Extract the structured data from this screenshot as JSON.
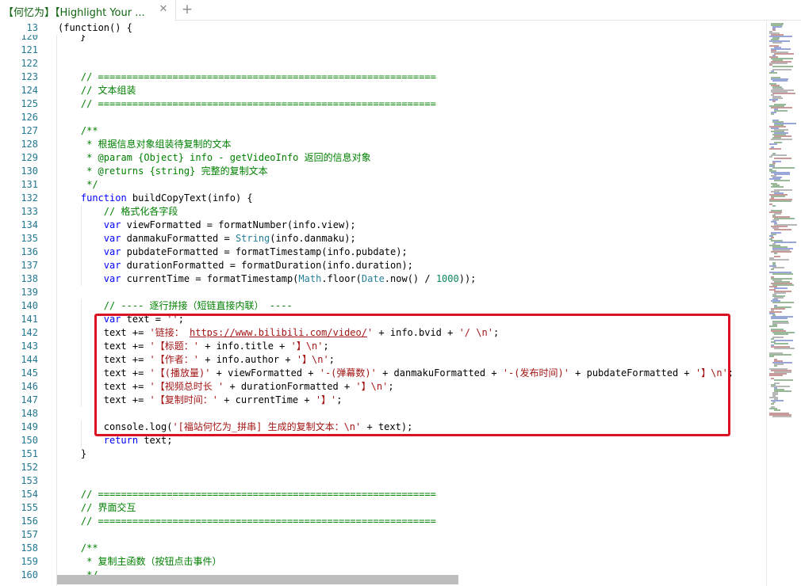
{
  "tab": {
    "title": "【何忆为】【Highlight Your ...",
    "close_glyph": "✕",
    "new_tab_glyph": "+"
  },
  "editor": {
    "sticky_line": {
      "number": "13",
      "text": "(function() {"
    },
    "partial_line": {
      "number": "120",
      "text": "}"
    },
    "lines": [
      {
        "number": "121",
        "indent": 0,
        "tokens": []
      },
      {
        "number": "122",
        "indent": 0,
        "tokens": []
      },
      {
        "number": "123",
        "indent": 1,
        "tokens": [
          {
            "t": "// ===========================================================",
            "c": "com"
          }
        ]
      },
      {
        "number": "124",
        "indent": 1,
        "tokens": [
          {
            "t": "// 文本组装",
            "c": "com"
          }
        ]
      },
      {
        "number": "125",
        "indent": 1,
        "tokens": [
          {
            "t": "// ===========================================================",
            "c": "com"
          }
        ]
      },
      {
        "number": "126",
        "indent": 0,
        "tokens": []
      },
      {
        "number": "127",
        "indent": 1,
        "tokens": [
          {
            "t": "/**",
            "c": "com"
          }
        ]
      },
      {
        "number": "128",
        "indent": 1,
        "tokens": [
          {
            "t": " * 根据信息对象组装待复制的文本",
            "c": "com"
          }
        ]
      },
      {
        "number": "129",
        "indent": 1,
        "tokens": [
          {
            "t": " * @param {Object} info - getVideoInfo 返回的信息对象",
            "c": "com"
          }
        ]
      },
      {
        "number": "130",
        "indent": 1,
        "tokens": [
          {
            "t": " * @returns {string} 完整的复制文本",
            "c": "com"
          }
        ]
      },
      {
        "number": "131",
        "indent": 1,
        "tokens": [
          {
            "t": " */",
            "c": "com"
          }
        ]
      },
      {
        "number": "132",
        "indent": 1,
        "tokens": [
          {
            "t": "function",
            "c": "kw"
          },
          {
            "t": " buildCopyText(info) {",
            "c": ""
          }
        ]
      },
      {
        "number": "133",
        "indent": 2,
        "tokens": [
          {
            "t": "// 格式化各字段",
            "c": "com"
          }
        ]
      },
      {
        "number": "134",
        "indent": 2,
        "tokens": [
          {
            "t": "var",
            "c": "kw"
          },
          {
            "t": " viewFormatted = formatNumber(info.view);",
            "c": ""
          }
        ]
      },
      {
        "number": "135",
        "indent": 2,
        "tokens": [
          {
            "t": "var",
            "c": "kw"
          },
          {
            "t": " danmakuFormatted = ",
            "c": ""
          },
          {
            "t": "String",
            "c": "type"
          },
          {
            "t": "(info.danmaku);",
            "c": ""
          }
        ]
      },
      {
        "number": "136",
        "indent": 2,
        "tokens": [
          {
            "t": "var",
            "c": "kw"
          },
          {
            "t": " pubdateFormatted = formatTimestamp(info.pubdate);",
            "c": ""
          }
        ]
      },
      {
        "number": "137",
        "indent": 2,
        "tokens": [
          {
            "t": "var",
            "c": "kw"
          },
          {
            "t": " durationFormatted = formatDuration(info.duration);",
            "c": ""
          }
        ]
      },
      {
        "number": "138",
        "indent": 2,
        "tokens": [
          {
            "t": "var",
            "c": "kw"
          },
          {
            "t": " currentTime = formatTimestamp(",
            "c": ""
          },
          {
            "t": "Math",
            "c": "type"
          },
          {
            "t": ".floor(",
            "c": ""
          },
          {
            "t": "Date",
            "c": "type"
          },
          {
            "t": ".now() / ",
            "c": ""
          },
          {
            "t": "1000",
            "c": "num"
          },
          {
            "t": "));",
            "c": ""
          }
        ]
      },
      {
        "number": "139",
        "indent": 0,
        "tokens": []
      },
      {
        "number": "140",
        "indent": 2,
        "tokens": [
          {
            "t": "// ---- 逐行拼接（短链直接内联） ----",
            "c": "com"
          }
        ]
      },
      {
        "number": "141",
        "indent": 2,
        "tokens": [
          {
            "t": "var",
            "c": "kw"
          },
          {
            "t": " text = ",
            "c": ""
          },
          {
            "t": "''",
            "c": "str"
          },
          {
            "t": ";",
            "c": ""
          }
        ]
      },
      {
        "number": "142",
        "indent": 2,
        "tokens": [
          {
            "t": "text += ",
            "c": ""
          },
          {
            "t": "'链接： ",
            "c": "str"
          },
          {
            "t": "https://www.bilibili.com/video/",
            "c": "str url"
          },
          {
            "t": "'",
            "c": "str"
          },
          {
            "t": " + info.bvid + ",
            "c": ""
          },
          {
            "t": "'/ \\n'",
            "c": "str"
          },
          {
            "t": ";",
            "c": ""
          }
        ]
      },
      {
        "number": "143",
        "indent": 2,
        "tokens": [
          {
            "t": "text += ",
            "c": ""
          },
          {
            "t": "'【标题：'",
            "c": "str"
          },
          {
            "t": " + info.title + ",
            "c": ""
          },
          {
            "t": "'】\\n'",
            "c": "str"
          },
          {
            "t": ";",
            "c": ""
          }
        ]
      },
      {
        "number": "144",
        "indent": 2,
        "tokens": [
          {
            "t": "text += ",
            "c": ""
          },
          {
            "t": "'【作者：'",
            "c": "str"
          },
          {
            "t": " + info.author + ",
            "c": ""
          },
          {
            "t": "'】\\n'",
            "c": "str"
          },
          {
            "t": ";",
            "c": ""
          }
        ]
      },
      {
        "number": "145",
        "indent": 2,
        "tokens": [
          {
            "t": "text += ",
            "c": ""
          },
          {
            "t": "'【(播放量)'",
            "c": "str"
          },
          {
            "t": " + viewFormatted + ",
            "c": ""
          },
          {
            "t": "'-(弹幕数)'",
            "c": "str"
          },
          {
            "t": " + danmakuFormatted + ",
            "c": ""
          },
          {
            "t": "'-(发布时间)'",
            "c": "str"
          },
          {
            "t": " + pubdateFormatted + ",
            "c": ""
          },
          {
            "t": "'】\\n'",
            "c": "str"
          },
          {
            "t": ";",
            "c": ""
          }
        ]
      },
      {
        "number": "146",
        "indent": 2,
        "tokens": [
          {
            "t": "text += ",
            "c": ""
          },
          {
            "t": "'【视频总时长 '",
            "c": "str"
          },
          {
            "t": " + durationFormatted + ",
            "c": ""
          },
          {
            "t": "'】\\n'",
            "c": "str"
          },
          {
            "t": ";",
            "c": ""
          }
        ]
      },
      {
        "number": "147",
        "indent": 2,
        "tokens": [
          {
            "t": "text += ",
            "c": ""
          },
          {
            "t": "'【复制时间：'",
            "c": "str"
          },
          {
            "t": " + currentTime + ",
            "c": ""
          },
          {
            "t": "'】'",
            "c": "str"
          },
          {
            "t": ";",
            "c": ""
          }
        ]
      },
      {
        "number": "148",
        "indent": 0,
        "tokens": []
      },
      {
        "number": "149",
        "indent": 2,
        "tokens": [
          {
            "t": "console.log(",
            "c": ""
          },
          {
            "t": "'[福站何忆为_拼串] 生成的复制文本：\\n'",
            "c": "str"
          },
          {
            "t": " + text);",
            "c": ""
          }
        ]
      },
      {
        "number": "150",
        "indent": 2,
        "tokens": [
          {
            "t": "return",
            "c": "kw"
          },
          {
            "t": " text;",
            "c": ""
          }
        ]
      },
      {
        "number": "151",
        "indent": 1,
        "tokens": [
          {
            "t": "}",
            "c": ""
          }
        ]
      },
      {
        "number": "152",
        "indent": 0,
        "tokens": []
      },
      {
        "number": "153",
        "indent": 0,
        "tokens": []
      },
      {
        "number": "154",
        "indent": 1,
        "tokens": [
          {
            "t": "// ===========================================================",
            "c": "com"
          }
        ]
      },
      {
        "number": "155",
        "indent": 1,
        "tokens": [
          {
            "t": "// 界面交互",
            "c": "com"
          }
        ]
      },
      {
        "number": "156",
        "indent": 1,
        "tokens": [
          {
            "t": "// ===========================================================",
            "c": "com"
          }
        ]
      },
      {
        "number": "157",
        "indent": 0,
        "tokens": []
      },
      {
        "number": "158",
        "indent": 1,
        "tokens": [
          {
            "t": "/**",
            "c": "com"
          }
        ]
      },
      {
        "number": "159",
        "indent": 1,
        "tokens": [
          {
            "t": " * 复制主函数（按钮点击事件）",
            "c": "com"
          }
        ]
      },
      {
        "number": "160",
        "indent": 1,
        "tokens": [
          {
            "t": " */",
            "c": "com"
          }
        ]
      }
    ]
  },
  "highlight": {
    "from_line": "141",
    "to_line": "147",
    "color": "#dd1122"
  },
  "colors": {
    "line_number": "#237893",
    "comment": "#008000",
    "keyword": "#0000ff",
    "string": "#a31515",
    "type": "#267f99",
    "number": "#098658"
  }
}
